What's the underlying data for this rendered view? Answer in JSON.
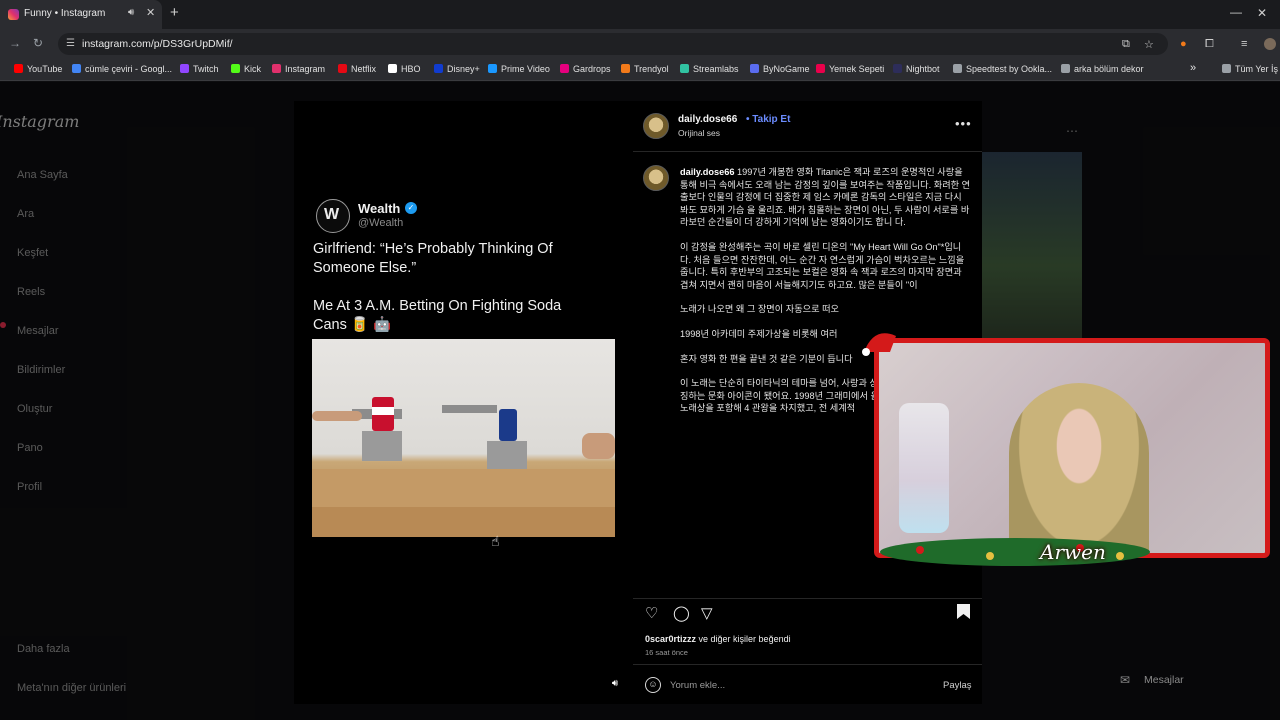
{
  "browser": {
    "tab": {
      "title": "Funny • Instagram"
    },
    "url": "instagram.com/p/DS3GrUpDMif/",
    "bookmarks": [
      {
        "label": "YouTube",
        "icon": "youtube-icon",
        "color": "#ff0000"
      },
      {
        "label": "cümle çeviri - Googl...",
        "icon": "google-icon",
        "color": "#4285f4"
      },
      {
        "label": "Twitch",
        "icon": "twitch-icon",
        "color": "#9146ff"
      },
      {
        "label": "Kick",
        "icon": "kick-icon",
        "color": "#53fc18"
      },
      {
        "label": "Instagram",
        "icon": "instagram-icon",
        "color": "#e1306c"
      },
      {
        "label": "Netflix",
        "icon": "netflix-icon",
        "color": "#e50914"
      },
      {
        "label": "HBO",
        "icon": "hbo-icon",
        "color": "#ffffff"
      },
      {
        "label": "Disney+",
        "icon": "disney-icon",
        "color": "#113ccf"
      },
      {
        "label": "Prime Video",
        "icon": "prime-icon",
        "color": "#1a98ff"
      },
      {
        "label": "Gardrops",
        "icon": "gardrops-icon",
        "color": "#e6007e"
      },
      {
        "label": "Trendyol",
        "icon": "trendyol-icon",
        "color": "#f27a1a"
      },
      {
        "label": "Streamlabs",
        "icon": "streamlabs-icon",
        "color": "#31c3a2"
      },
      {
        "label": "ByNoGame",
        "icon": "bynogame-icon",
        "color": "#5a6cf0"
      },
      {
        "label": "Yemek Sepeti",
        "icon": "yemeksepeti-icon",
        "color": "#ea004b"
      },
      {
        "label": "Nightbot",
        "icon": "nightbot-icon",
        "color": "#2d2d5a"
      },
      {
        "label": "Speedtest by Ookla...",
        "icon": "speedtest-icon",
        "color": "#9aa0a6"
      },
      {
        "label": "arka bölüm dekor",
        "icon": "folder-icon",
        "color": "#9aa0a6"
      }
    ],
    "bookmarks_more": "»",
    "bookmarks_all": "Tüm Yer İş"
  },
  "instagram": {
    "logo": "Instagram",
    "sidebar": [
      {
        "label": "Ana Sayfa"
      },
      {
        "label": "Ara"
      },
      {
        "label": "Keşfet"
      },
      {
        "label": "Reels"
      },
      {
        "label": "Mesajlar"
      },
      {
        "label": "Bildirimler"
      },
      {
        "label": "Oluştur"
      },
      {
        "label": "Pano"
      },
      {
        "label": "Profil"
      }
    ],
    "sidebar_bottom": [
      {
        "label": "Daha fazla"
      },
      {
        "label": "Meta'nın diğer ürünleri"
      }
    ]
  },
  "post": {
    "tweet": {
      "name": "Wealth",
      "handle": "@Wealth",
      "line1": "Girlfriend: “He’s Probably Thinking Of",
      "line2": "Someone Else.”",
      "line3": "Me At 3 A.M. Betting On Fighting Soda",
      "line4": "Cans 🥫 🤖"
    },
    "author": "daily.dose66",
    "follow_label": "Takip Et",
    "audio": "Orijinal ses",
    "caption_user": "daily.dose66",
    "caption": [
      "1997년 개봉한 영화 Titanic은 잭과 로즈의 운명적인 사랑을 통해 비극 속에서도 오래 남는 감정의 깊이를 보여주는 작품입니다. 화려한 연출보다 인물의 감정에 더 집중한 제 임스 카메론 감독의 스타일은 지금 다시 봐도 묘하게 가슴 을 울리죠. 배가 침몰하는 장면이 아닌, 두 사람이 서로를 바 라보던 순간들이 더 강하게 기억에 남는 영화이기도 합니 다.",
      "이 감정을 완성해주는 곡이 바로 셀린 디온의 \"My Heart Will Go On\"*입니다. 처음 들으면 잔잔한데, 어느 순간 자 연스럽게 가슴이 벅차오르는 느낌을 줍니다. 특히 후반부의 고조되는 보컬은 영화 속 잭과 로즈의 마지막 장면과 겹쳐 지면서 괜히 마음이 서늘해지기도 하고요. 많은 분들이 \"이",
      "노래가 나오면 왜 그 장면이 자동으로 떠오",
      "1998년 아카데미 주제가상을 비롯해 여러",
      "혼자 영화 한 편을 끝낸 것 같은 기분이 듭니다",
      "이 노래는 단순히 타이타닉의 테마를 넘어, 사랑과 상실의 보편적인 감정을 상징하는 문화 아이콘이 됐어요. 1998년 그래미에서 올해의 레코드상과 올해의 노래상을 포함해 4 관왕을 차지했고, 전 세계적"
    ],
    "likes_user": "0scar0rtizzz",
    "likes_suffix": " ve diğer kişiler beğendi",
    "timestamp": "16 saat önce",
    "comment_placeholder": "Yorum ekle...",
    "share_label": "Paylaş"
  },
  "messages_bubble": {
    "label": "Mesajlar",
    "badge": "7"
  },
  "webcam": {
    "name": "Arwen"
  }
}
